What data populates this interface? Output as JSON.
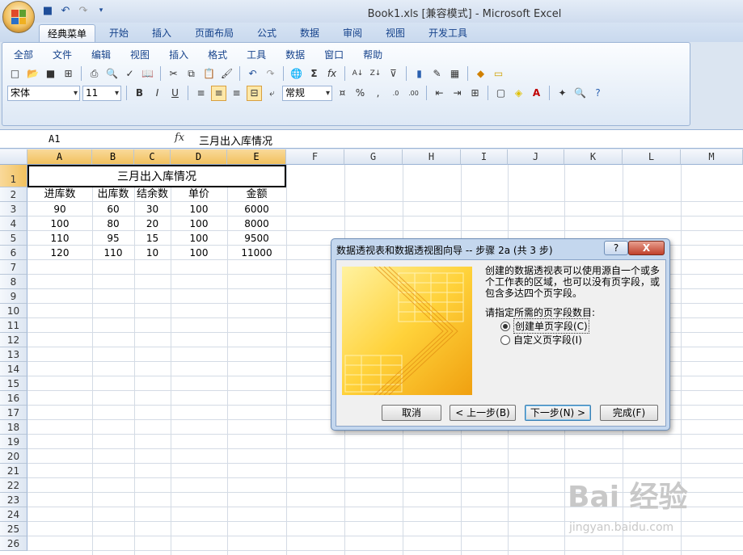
{
  "window": {
    "title": "Book1.xls  [兼容模式] - Microsoft Excel"
  },
  "tabs": [
    "经典菜单",
    "开始",
    "插入",
    "页面布局",
    "公式",
    "数据",
    "审阅",
    "视图",
    "开发工具"
  ],
  "menu": [
    "全部",
    "文件",
    "编辑",
    "视图",
    "插入",
    "格式",
    "工具",
    "数据",
    "窗口",
    "帮助"
  ],
  "toolbar": {
    "font": "宋体",
    "size": "11",
    "format": "常规"
  },
  "formula": {
    "name": "A1",
    "fx": "fx",
    "content": "三月出入库情况"
  },
  "columns": [
    "A",
    "B",
    "C",
    "D",
    "E",
    "F",
    "G",
    "H",
    "I",
    "J",
    "K",
    "L",
    "M"
  ],
  "rows": [
    "1",
    "2",
    "3",
    "4",
    "5",
    "6",
    "7",
    "8",
    "9",
    "10",
    "11",
    "12",
    "13",
    "14",
    "15",
    "16",
    "17",
    "18",
    "19",
    "20",
    "21",
    "22",
    "23",
    "24",
    "25",
    "26"
  ],
  "sheet": {
    "title": "三月出入库情况",
    "headers": [
      "进库数",
      "出库数",
      "结余数",
      "单价",
      "金额"
    ],
    "data": [
      [
        "90",
        "60",
        "30",
        "100",
        "6000"
      ],
      [
        "100",
        "80",
        "20",
        "100",
        "8000"
      ],
      [
        "110",
        "95",
        "15",
        "100",
        "9500"
      ],
      [
        "120",
        "110",
        "10",
        "100",
        "11000"
      ]
    ]
  },
  "dialog": {
    "title": "数据透视表和数据透视图向导 -- 步骤 2a (共 3 步)",
    "help": "?",
    "close": "X",
    "description": "创建的数据透视表可以使用源自一个或多个工作表的区域，也可以没有页字段，或包含多达四个页字段。",
    "prompt": "请指定所需的页字段数目:",
    "option1": "创建单页字段(C)",
    "option2": "自定义页字段(I)",
    "btn_cancel": "取消",
    "btn_back": "< 上一步(B)",
    "btn_next": "下一步(N) >",
    "btn_finish": "完成(F)"
  },
  "watermark": {
    "brand": "Bai 经验",
    "url": "jingyan.baidu.com"
  },
  "colors": {
    "accent": "#15428b",
    "selected_header": "#f1c15e",
    "dialog_frame": "#c4d7ee"
  }
}
